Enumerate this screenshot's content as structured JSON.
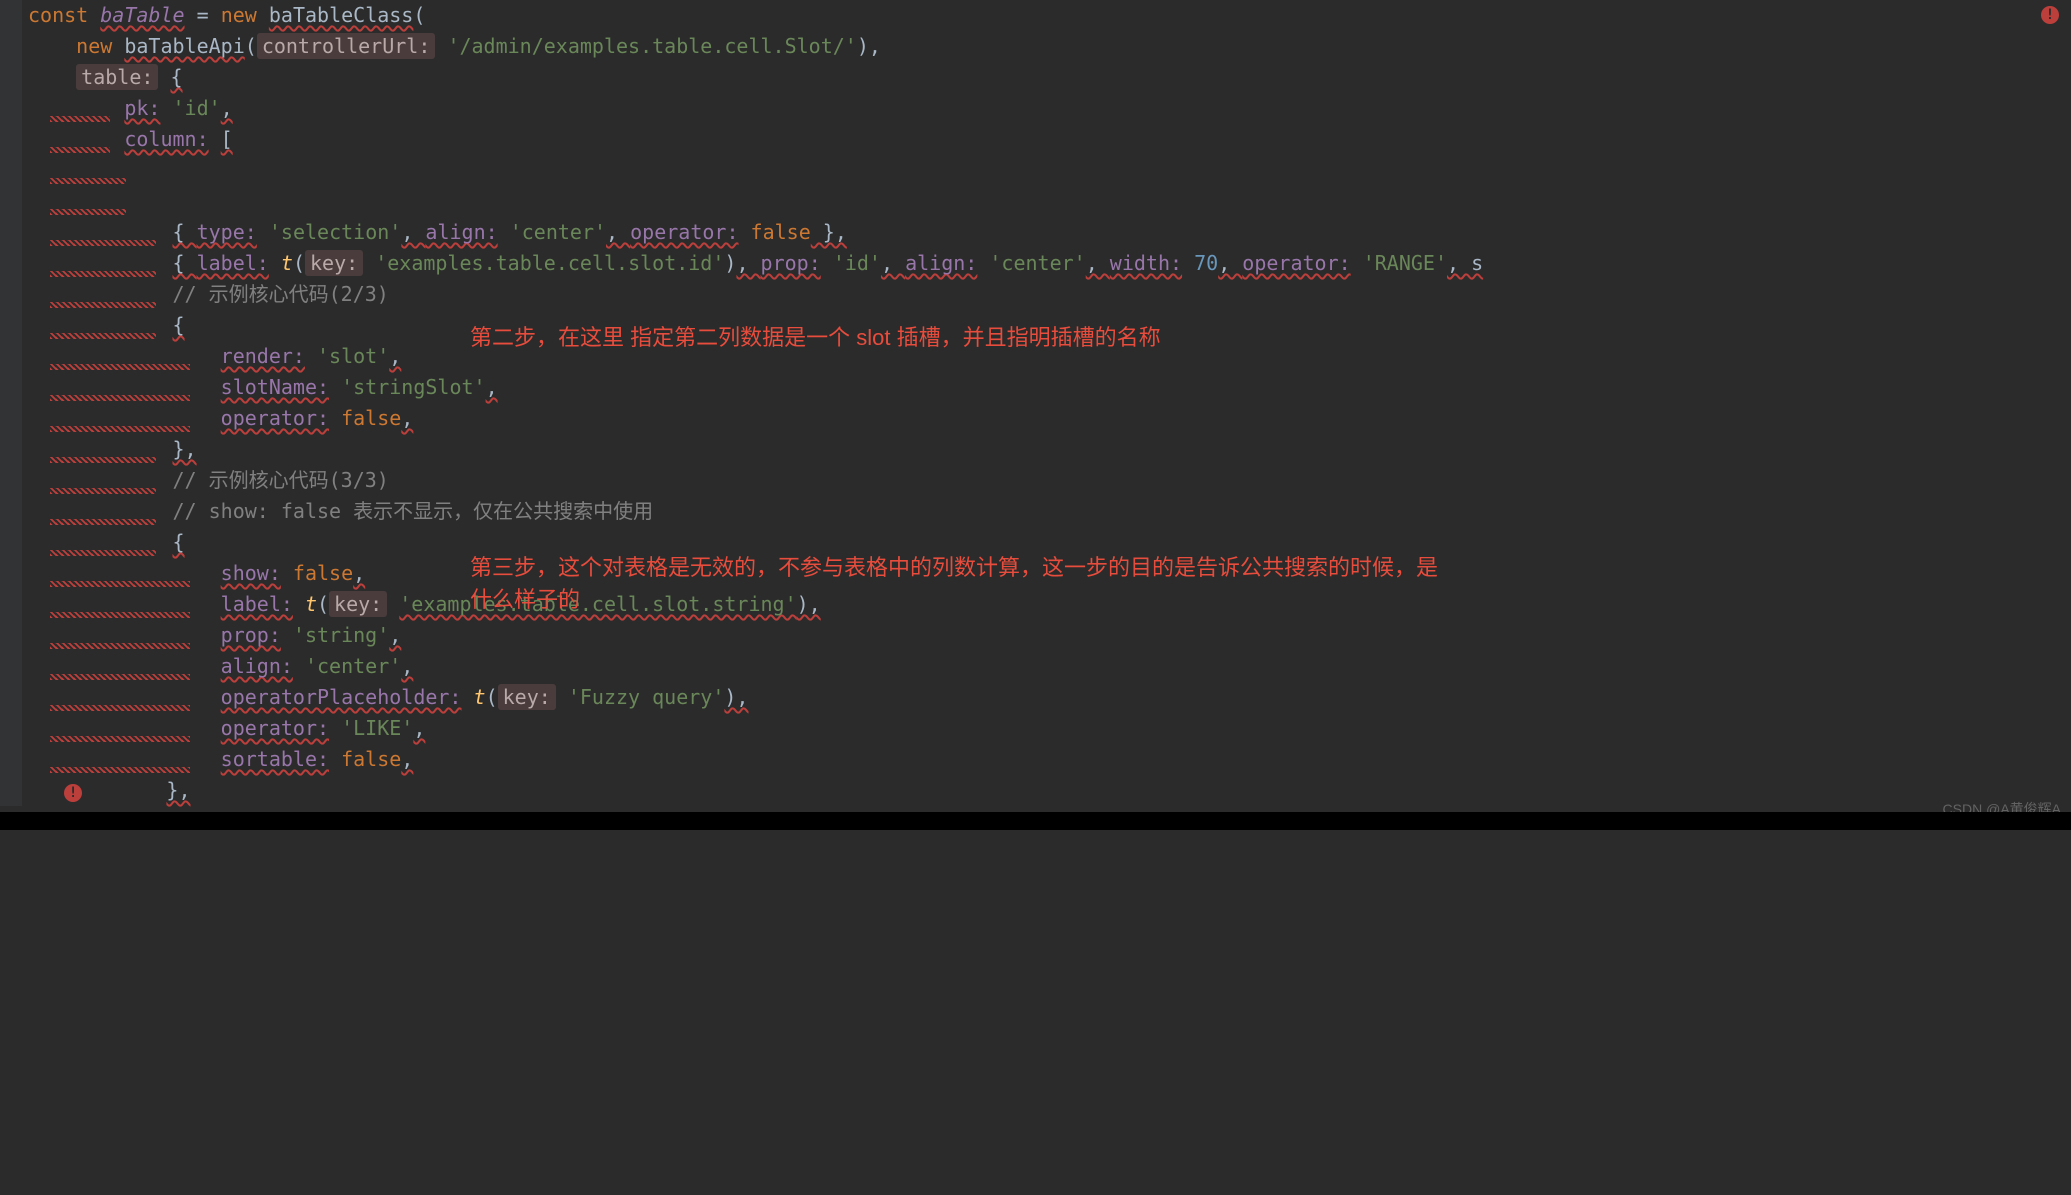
{
  "code": {
    "line1": {
      "const": "const",
      "var": "baTable",
      "eq": " = ",
      "new": "new",
      "cls": "baTableClass",
      "paren": "("
    },
    "line2": {
      "new": "new",
      "cls": "baTableApi",
      "paren": "(",
      "hint": "controllerUrl:",
      "str": "'/admin/examples.table.cell.Slot/'",
      "close": "),"
    },
    "line3": {
      "hint": "table:",
      "brace": "{"
    },
    "line4": {
      "prop": "pk:",
      "str": "'id'",
      "comma": ","
    },
    "line5": {
      "prop": "column:",
      "bracket": "["
    },
    "line7": {
      "open": "{ ",
      "p1": "type:",
      "v1": "'selection'",
      "p2": "align:",
      "v2": "'center'",
      "p3": "operator:",
      "v3": "false",
      "close": " },"
    },
    "line8": {
      "open": "{ ",
      "p1": "label:",
      "fn": "t",
      "hint": "key:",
      "str": "'examples.table.cell.slot.id'",
      "p2": "prop:",
      "v2": "'id'",
      "p3": "align:",
      "v3": "'center'",
      "p4": "width:",
      "v4": "70",
      "p5": "operator:",
      "v5": "'RANGE'",
      "tail": ", s"
    },
    "line9": {
      "cmt": "// 示例核心代码(2/3)"
    },
    "line10": {
      "brace": "{"
    },
    "line11": {
      "prop": "render:",
      "str": "'slot'",
      "comma": ","
    },
    "line12": {
      "prop": "slotName:",
      "str": "'stringSlot'",
      "comma": ","
    },
    "line13": {
      "prop": "operator:",
      "val": "false",
      "comma": ","
    },
    "line14": {
      "close": "},"
    },
    "line15": {
      "cmt": "// 示例核心代码(3/3)"
    },
    "line16": {
      "cmt": "// show: false 表示不显示，仅在公共搜索中使用"
    },
    "line17": {
      "brace": "{"
    },
    "line18": {
      "prop": "show:",
      "val": "false",
      "comma": ","
    },
    "line19": {
      "prop": "label:",
      "fn": "t",
      "hint": "key:",
      "str": "'examples.table.cell.slot.string'",
      "close": "),"
    },
    "line20": {
      "prop": "prop:",
      "str": "'string'",
      "comma": ","
    },
    "line21": {
      "prop": "align:",
      "str": "'center'",
      "comma": ","
    },
    "line22": {
      "prop": "operatorPlaceholder:",
      "fn": "t",
      "hint": "key:",
      "str": "'Fuzzy query'",
      "close": "),"
    },
    "line23": {
      "prop": "operator:",
      "str": "'LIKE'",
      "comma": ","
    },
    "line24": {
      "prop": "sortable:",
      "val": "false",
      "comma": ","
    },
    "line25": {
      "close": "},"
    }
  },
  "annotations": {
    "a1": "第二步，在这里 指定第二列数据是一个 slot 插槽，并且指明插槽的名称",
    "a2": "第三步，这个对表格是无效的，不参与表格中的列数计算，这一步的目的是告诉公共搜索的时候，是什么样子的"
  },
  "watermark": "CSDN @A黄俊辉A",
  "icons": {
    "error": "!"
  }
}
